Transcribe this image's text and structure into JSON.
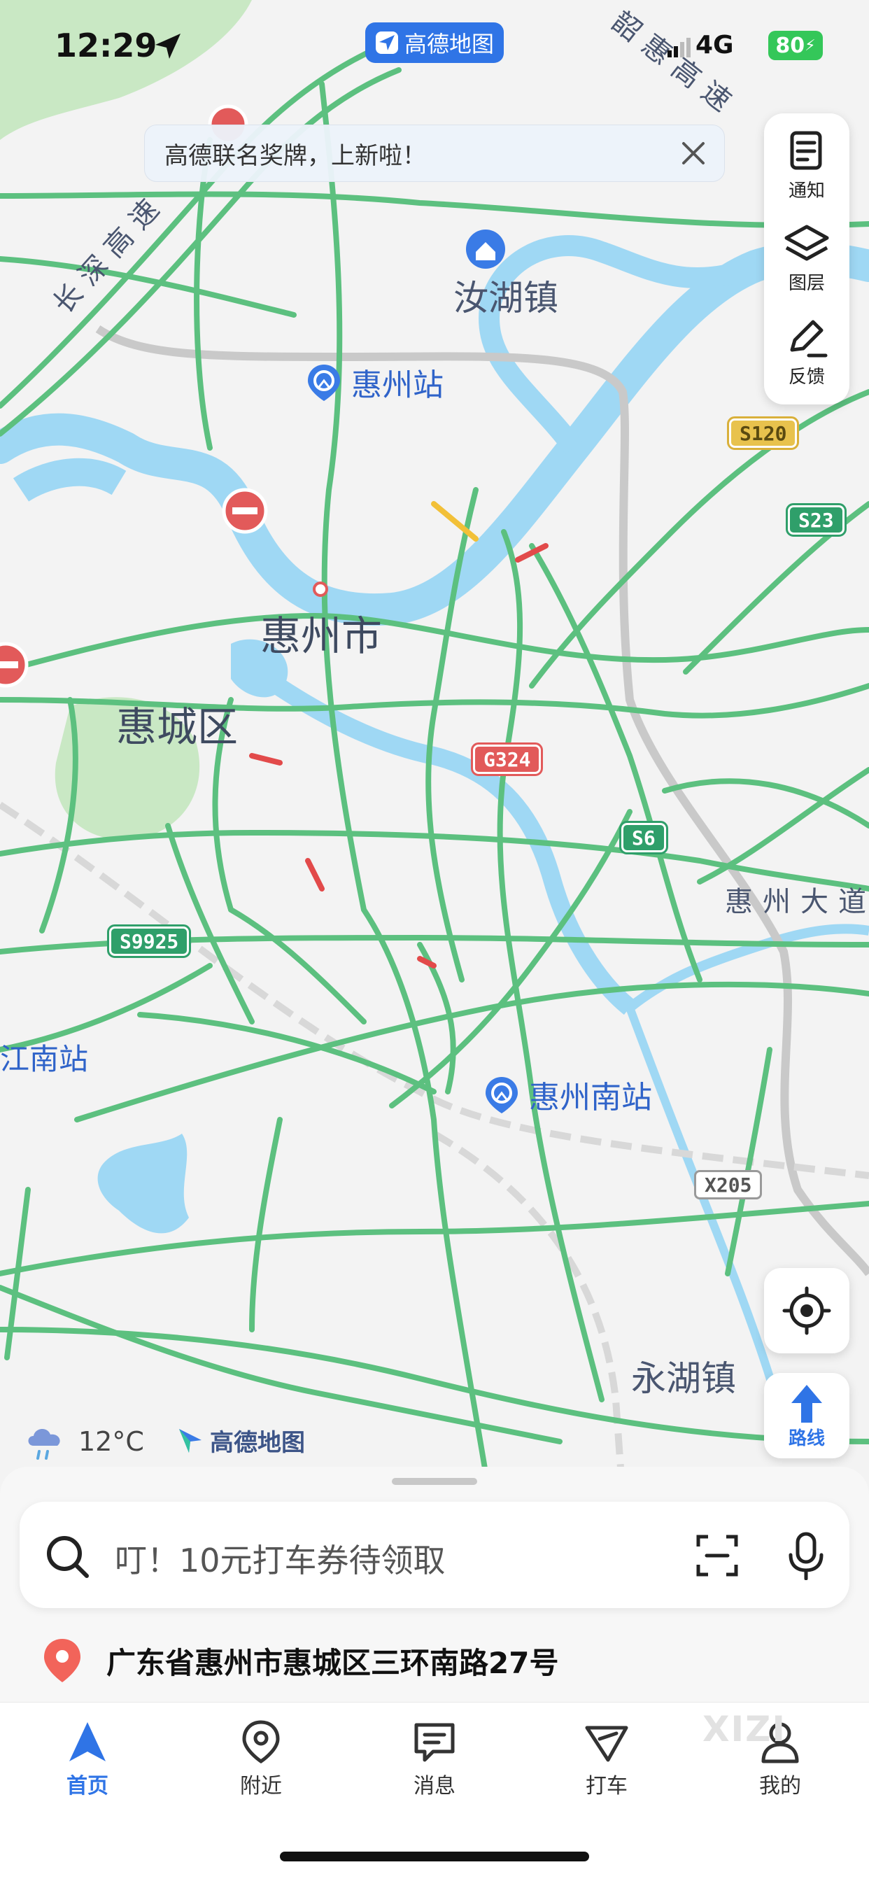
{
  "status_bar": {
    "time": "12:29",
    "app_name": "高德地图",
    "network": "4G",
    "battery": "80"
  },
  "banner": {
    "text": "高德联名奖牌，上新啦！"
  },
  "side_panel": {
    "notice": "通知",
    "layers": "图层",
    "feedback": "反馈"
  },
  "map": {
    "labels": {
      "city": "惠州市",
      "district": "惠城区",
      "town_ruhu": "汝湖镇",
      "town_yonghu": "永湖镇",
      "expressway_changshen": "长深高速",
      "expressway_shaohui": "韶惠高速",
      "road_huizhou_dadao": "惠州大道",
      "jiangnan_station": "江南站"
    },
    "pois": {
      "huizhou_station": "惠州站",
      "huizhou_south_station": "惠州南站"
    },
    "shields": {
      "g324": "G324",
      "s120": "S120",
      "s23": "S23",
      "s6": "S6",
      "s9925": "S9925",
      "x205": "X205"
    },
    "colors": {
      "water": "#9fd8f4",
      "green_area": "#c9e8c4",
      "road_green": "#5cc07f",
      "road_gray": "#c9c9c9"
    }
  },
  "weather": {
    "temperature": "12°C"
  },
  "map_logo": "高德地图",
  "route_button": {
    "label": "路线"
  },
  "search": {
    "placeholder": "叮！10元打车券待领取"
  },
  "address": {
    "text": "广东省惠州市惠城区三环南路27号"
  },
  "tabs": [
    {
      "label": "首页",
      "icon": "home-arrow-icon",
      "active": true
    },
    {
      "label": "附近",
      "icon": "location-pin-icon",
      "active": false
    },
    {
      "label": "消息",
      "icon": "message-icon",
      "active": false
    },
    {
      "label": "打车",
      "icon": "taxi-icon",
      "active": false
    },
    {
      "label": "我的",
      "icon": "user-icon",
      "active": false
    }
  ],
  "watermark": "XIZI",
  "accent_color": "#2f74e6"
}
